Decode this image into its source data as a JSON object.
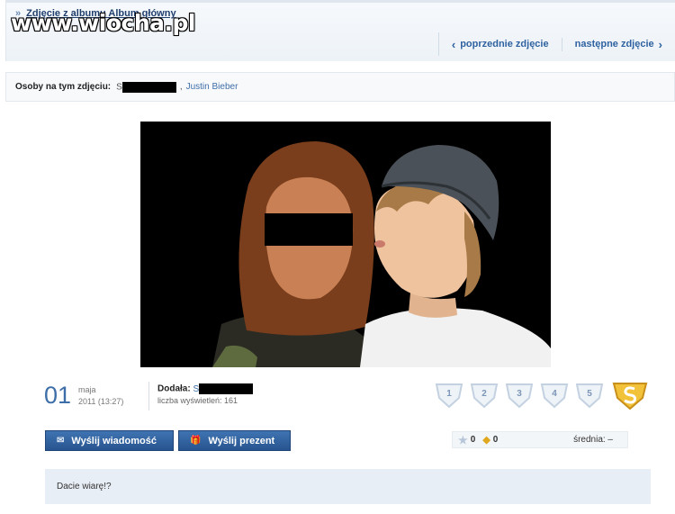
{
  "watermark": "www.wiocha.pl",
  "album": {
    "crumb": "Zdjęcie z albumu Album główny",
    "prev_label": "poprzednie zdjęcie",
    "next_label": "następne zdjęcie"
  },
  "people": {
    "label": "Osoby na tym zdjęciu:",
    "person1_initial": "S",
    "separator": ",",
    "person2": "Justin Bieber"
  },
  "date": {
    "day": "01",
    "month": "maja",
    "year_time": "2011 (13:27)"
  },
  "uploader": {
    "label": "Dodała:",
    "name_initial": "S",
    "views": "liczba wyświetleń: 161"
  },
  "ratings": [
    "1",
    "2",
    "3",
    "4",
    "5"
  ],
  "buttons": {
    "message": "Wyślij wiadomość",
    "gift": "Wyślij prezent"
  },
  "stats": {
    "stars": "0",
    "supers": "0",
    "average": "średnia: –"
  },
  "description": "Dacie wiarę!?",
  "colors": {
    "accent": "#2f62a0",
    "button": "#27548f",
    "desc_bg": "#e8eef6"
  }
}
